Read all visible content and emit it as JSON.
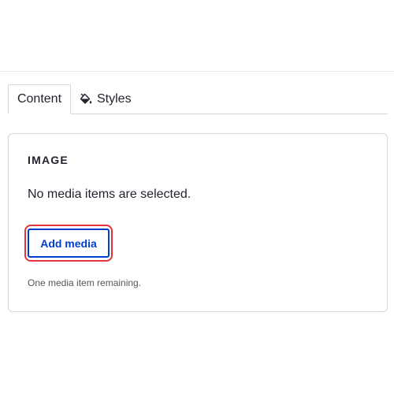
{
  "tabs": [
    {
      "label": "Content"
    },
    {
      "label": "Styles",
      "icon": "paint-bucket-icon"
    }
  ],
  "image_field": {
    "title": "IMAGE",
    "message": "No media items are selected.",
    "add_button_label": "Add media",
    "help_text": "One media item remaining."
  },
  "colors": {
    "accent": "#003ecc",
    "focus_ring": "#e0333a",
    "text": "#222330",
    "border": "#d8d8dc"
  }
}
